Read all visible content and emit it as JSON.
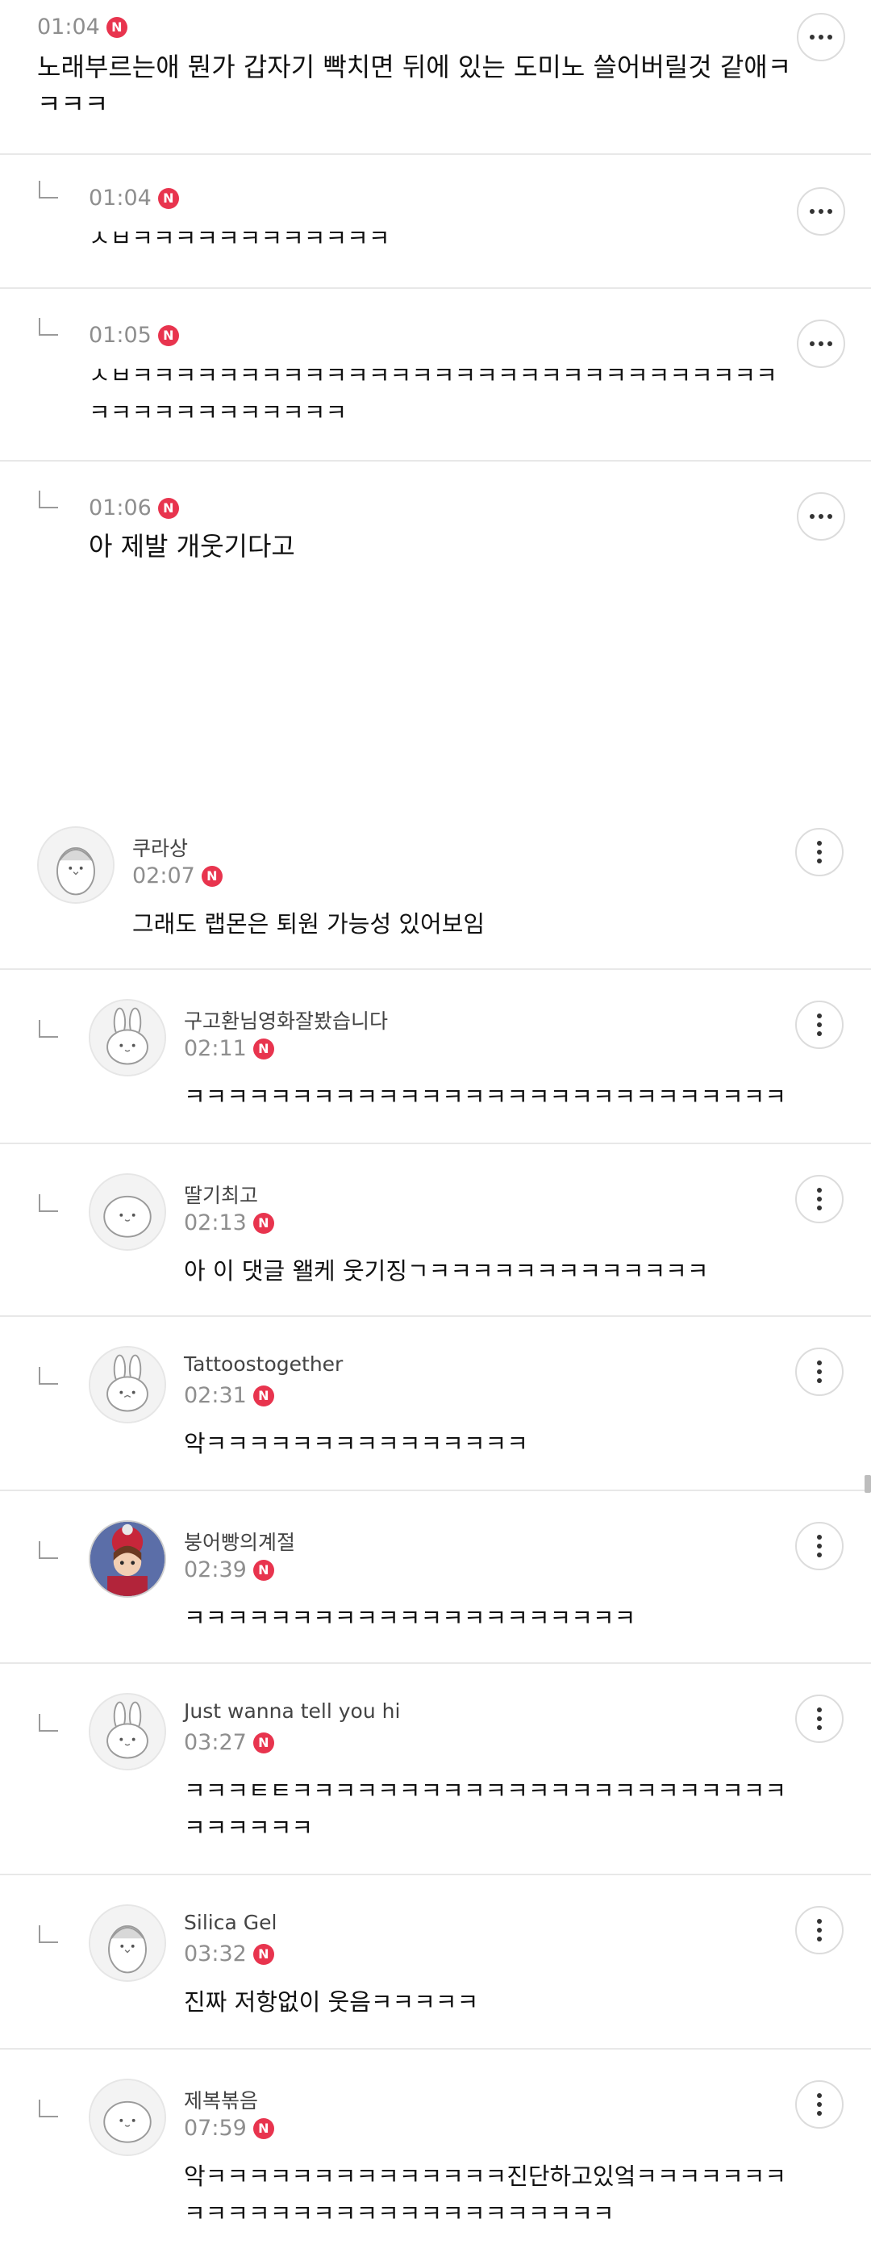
{
  "comments": [
    {
      "time": "01:04",
      "badge": "N",
      "text": "노래부르는애 뭔가 갑자기 빡치면 뒤에 있는 도미노 쓸어버릴것 같애ㅋㅋㅋㅋ"
    },
    {
      "time": "01:04",
      "badge": "N",
      "text": "ㅅㅂㅋㅋㅋㅋㅋㅋㅋㅋㅋㅋㅋㅋ"
    },
    {
      "time": "01:05",
      "badge": "N",
      "text": "ㅅㅂㅋㅋㅋㅋㅋㅋㅋㅋㅋㅋㅋㅋㅋㅋㅋㅋㅋㅋㅋㅋㅋㅋㅋㅋㅋㅋㅋㅋㅋㅋㅋㅋㅋㅋㅋㅋㅋㅋㅋㅋㅋㅋ"
    },
    {
      "time": "01:06",
      "badge": "N",
      "text": "아 제발 개웃기다고"
    },
    {
      "name": "쿠라상",
      "time": "02:07",
      "badge": "N",
      "text": "그래도 랩몬은 퇴원 가능성 있어보임"
    },
    {
      "name": "구고환님영화잘봤습니다",
      "time": "02:11",
      "badge": "N",
      "text": "ㅋㅋㅋㅋㅋㅋㅋㅋㅋㅋㅋㅋㅋㅋㅋㅋㅋㅋㅋㅋㅋㅋㅋㅋㅋㅋㅋㅋ"
    },
    {
      "name": "딸기최고",
      "time": "02:13",
      "badge": "N",
      "text": "아 이 댓글 왤케 웃기징ㄱㅋㅋㅋㅋㅋㅋㅋㅋㅋㅋㅋㅋㅋ"
    },
    {
      "name": "Tattoostogether",
      "time": "02:31",
      "badge": "N",
      "text": "악ㅋㅋㅋㅋㅋㅋㅋㅋㅋㅋㅋㅋㅋㅋㅋ"
    },
    {
      "name": "붕어빵의계절",
      "time": "02:39",
      "badge": "N",
      "text": "ㅋㅋㅋㅋㅋㅋㅋㅋㅋㅋㅋㅋㅋㅋㅋㅋㅋㅋㅋㅋㅋ"
    },
    {
      "name": "Just wanna tell you hi",
      "time": "03:27",
      "badge": "N",
      "text": "ㅋㅋㅋㅌㅌㅋㅋㅋㅋㅋㅋㅋㅋㅋㅋㅋㅋㅋㅋㅋㅋㅋㅋㅋㅋㅋㅋㅋㅋㅋㅋㅋㅋㅋ"
    },
    {
      "name": "Silica Gel",
      "time": "03:32",
      "badge": "N",
      "text": "진짜 저항없이 웃음ㅋㅋㅋㅋㅋ"
    },
    {
      "name": "제복볶음",
      "time": "07:59",
      "badge": "N",
      "text": "악ㅋㅋㅋㅋㅋㅋㅋㅋㅋㅋㅋㅋㅋㅋ진단하고있엌ㅋㅋㅋㅋㅋㅋㅋㅋㅋㅋㅋㅋㅋㅋㅋㅋㅋㅋㅋㅋㅋㅋㅋㅋㅋㅋㅋ"
    }
  ]
}
